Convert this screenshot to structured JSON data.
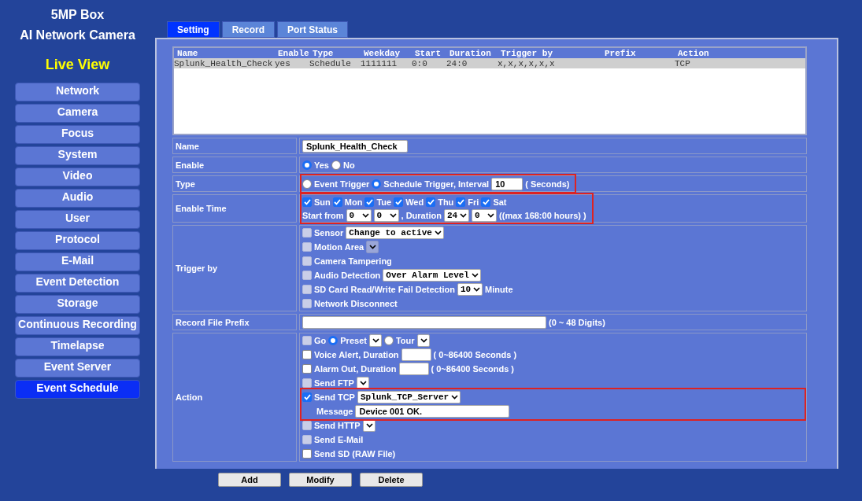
{
  "header": {
    "model": "5MP Box",
    "product": "AI Network Camera"
  },
  "sidebar": {
    "live_view": "Live View",
    "items": [
      {
        "label": "Network",
        "selected": false
      },
      {
        "label": "Camera",
        "selected": false
      },
      {
        "label": "Focus",
        "selected": false
      },
      {
        "label": "System",
        "selected": false
      },
      {
        "label": "Video",
        "selected": false
      },
      {
        "label": "Audio",
        "selected": false
      },
      {
        "label": "User",
        "selected": false
      },
      {
        "label": "Protocol",
        "selected": false
      },
      {
        "label": "E-Mail",
        "selected": false
      },
      {
        "label": "Event Detection",
        "selected": false
      },
      {
        "label": "Storage",
        "selected": false
      },
      {
        "label": "Continuous Recording",
        "selected": false
      },
      {
        "label": "Timelapse",
        "selected": false
      },
      {
        "label": "Event Server",
        "selected": false
      },
      {
        "label": "Event Schedule",
        "selected": true
      }
    ]
  },
  "tabs": [
    {
      "label": "Setting",
      "selected": true
    },
    {
      "label": "Record",
      "selected": false
    },
    {
      "label": "Port Status",
      "selected": false
    }
  ],
  "event_list": {
    "columns": [
      "Name",
      "Enable",
      "Type",
      "Weekday",
      "Start",
      "Duration",
      "Trigger by",
      "Prefix",
      "Action"
    ],
    "rows": [
      {
        "selected": true,
        "cells": [
          "Splunk_Health_Check",
          "yes",
          "Schedule",
          "1111111",
          "0:0",
          "24:0",
          "x,x,x,x,x,x",
          "",
          "TCP"
        ]
      }
    ]
  },
  "form": {
    "rows": [
      {
        "label": "Name",
        "kind": "text",
        "value": "Splunk_Health_Check"
      },
      {
        "label": "Enable",
        "kind": "radios",
        "options": [
          {
            "label": "Yes",
            "selected": true
          },
          {
            "label": "No",
            "selected": false
          }
        ]
      },
      {
        "label": "Type",
        "kind": "type",
        "highlighted": true,
        "options": [
          {
            "label": "Event Trigger",
            "selected": false
          },
          {
            "label": "Schedule Trigger, Interval",
            "selected": true
          }
        ],
        "value": "10",
        "suffix": "( Seconds)"
      },
      {
        "label": "Enable Time",
        "kind": "schedule",
        "highlighted": true,
        "days": [
          {
            "label": "Sun",
            "checked": true
          },
          {
            "label": "Mon",
            "checked": true
          },
          {
            "label": "Tue",
            "checked": true
          },
          {
            "label": "Wed",
            "checked": true
          },
          {
            "label": "Thu",
            "checked": true
          },
          {
            "label": "Fri",
            "checked": true
          },
          {
            "label": "Sat",
            "checked": true
          }
        ],
        "start_label": "Start from",
        "start": [
          "0",
          "0"
        ],
        "duration_label": ", Duration",
        "duration": [
          "24",
          "0"
        ],
        "note": "((max 168:00 hours) )"
      },
      {
        "label": "Trigger by",
        "kind": "checklist",
        "items": [
          {
            "kind": "check",
            "label": "Sensor",
            "checked": false,
            "disabled": true,
            "select": {
              "value": "Change to active",
              "disabled": false
            }
          },
          {
            "kind": "check",
            "label": "Motion Area",
            "checked": false,
            "disabled": true,
            "select": {
              "disabled": true
            }
          },
          {
            "kind": "check",
            "label": "Camera Tampering",
            "checked": false,
            "disabled": true
          },
          {
            "kind": "check",
            "label": "Audio Detection",
            "checked": false,
            "disabled": true,
            "select": {
              "value": "Over Alarm Level",
              "disabled": false
            }
          },
          {
            "kind": "check",
            "label": "SD Card Read/Write Fail Detection",
            "checked": false,
            "disabled": true,
            "select": {
              "value": "10",
              "disabled": false
            },
            "suffix": "Minute"
          },
          {
            "kind": "check",
            "label": "Network Disconnect",
            "checked": false,
            "disabled": true
          }
        ]
      },
      {
        "label": "Record File Prefix",
        "kind": "prefix",
        "suffix": "(0 ~ 48 Digits)"
      },
      {
        "label": "Action",
        "kind": "checklist",
        "items": [
          {
            "kind": "go",
            "label": "Go",
            "checked": false,
            "disabled": true,
            "options": [
              {
                "label": "Preset",
                "selected": true
              },
              {
                "label": "Tour",
                "selected": false
              }
            ]
          },
          {
            "kind": "duration",
            "label": "Voice Alert, Duration",
            "checked": false,
            "disabled": false,
            "suffix": "( 0~86400 Seconds )"
          },
          {
            "kind": "duration",
            "label": "Alarm Out, Duration",
            "checked": false,
            "disabled": false,
            "suffix": "( 0~86400 Seconds )"
          },
          {
            "kind": "check",
            "label": "Send FTP",
            "checked": false,
            "disabled": true,
            "select": {
              "disabled": false
            }
          },
          {
            "kind": "tcp",
            "label": "Send TCP",
            "checked": true,
            "disabled": false,
            "highlighted": true,
            "select": {
              "value": "Splunk_TCP_Server",
              "disabled": false
            },
            "message_label": "Message",
            "message": "Device 001 OK."
          },
          {
            "kind": "check",
            "label": "Send HTTP",
            "checked": false,
            "disabled": true,
            "select": {
              "disabled": false
            }
          },
          {
            "kind": "check",
            "label": "Send E-Mail",
            "checked": false,
            "disabled": true
          },
          {
            "kind": "check",
            "label": "Send SD  (RAW File)",
            "checked": false,
            "disabled": false
          }
        ]
      }
    ]
  },
  "buttons": [
    "Add",
    "Modify",
    "Delete"
  ]
}
